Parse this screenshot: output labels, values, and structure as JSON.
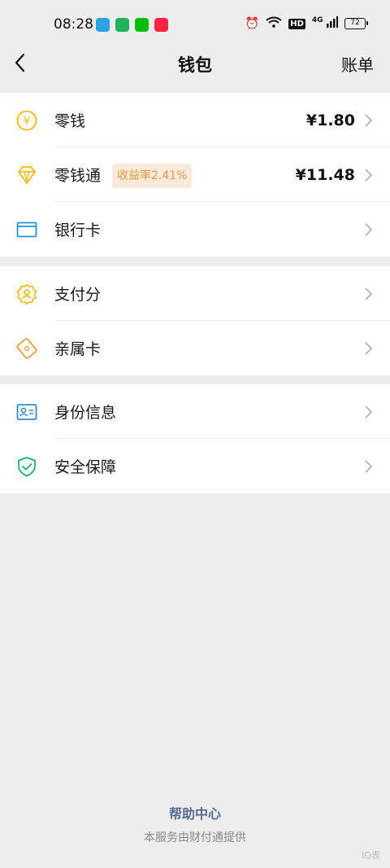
{
  "status": {
    "time": "08:28",
    "battery": "72",
    "network": "4G",
    "hd": "HD"
  },
  "nav": {
    "title": "钱包",
    "right": "账单"
  },
  "sections": [
    {
      "items": [
        {
          "label": "零钱",
          "value": "¥1.80",
          "icon": "yen-coin-icon",
          "color": "#f2b90c"
        },
        {
          "label": "零钱通",
          "value": "¥11.48",
          "badge": "收益率2.41%",
          "icon": "diamond-icon",
          "color": "#f2b90c"
        },
        {
          "label": "银行卡",
          "icon": "card-icon",
          "color": "#2f8fd8"
        }
      ]
    },
    {
      "items": [
        {
          "label": "支付分",
          "icon": "score-badge-icon",
          "color": "#f2b90c"
        },
        {
          "label": "亲属卡",
          "icon": "family-card-icon",
          "color": "#f0a040"
        }
      ]
    },
    {
      "items": [
        {
          "label": "身份信息",
          "icon": "id-card-icon",
          "color": "#2f8fd8"
        },
        {
          "label": "安全保障",
          "icon": "shield-icon",
          "color": "#16b36b"
        }
      ]
    }
  ],
  "footer": {
    "link": "帮助中心",
    "note": "本服务由财付通提供"
  },
  "watermark": "IQ表"
}
